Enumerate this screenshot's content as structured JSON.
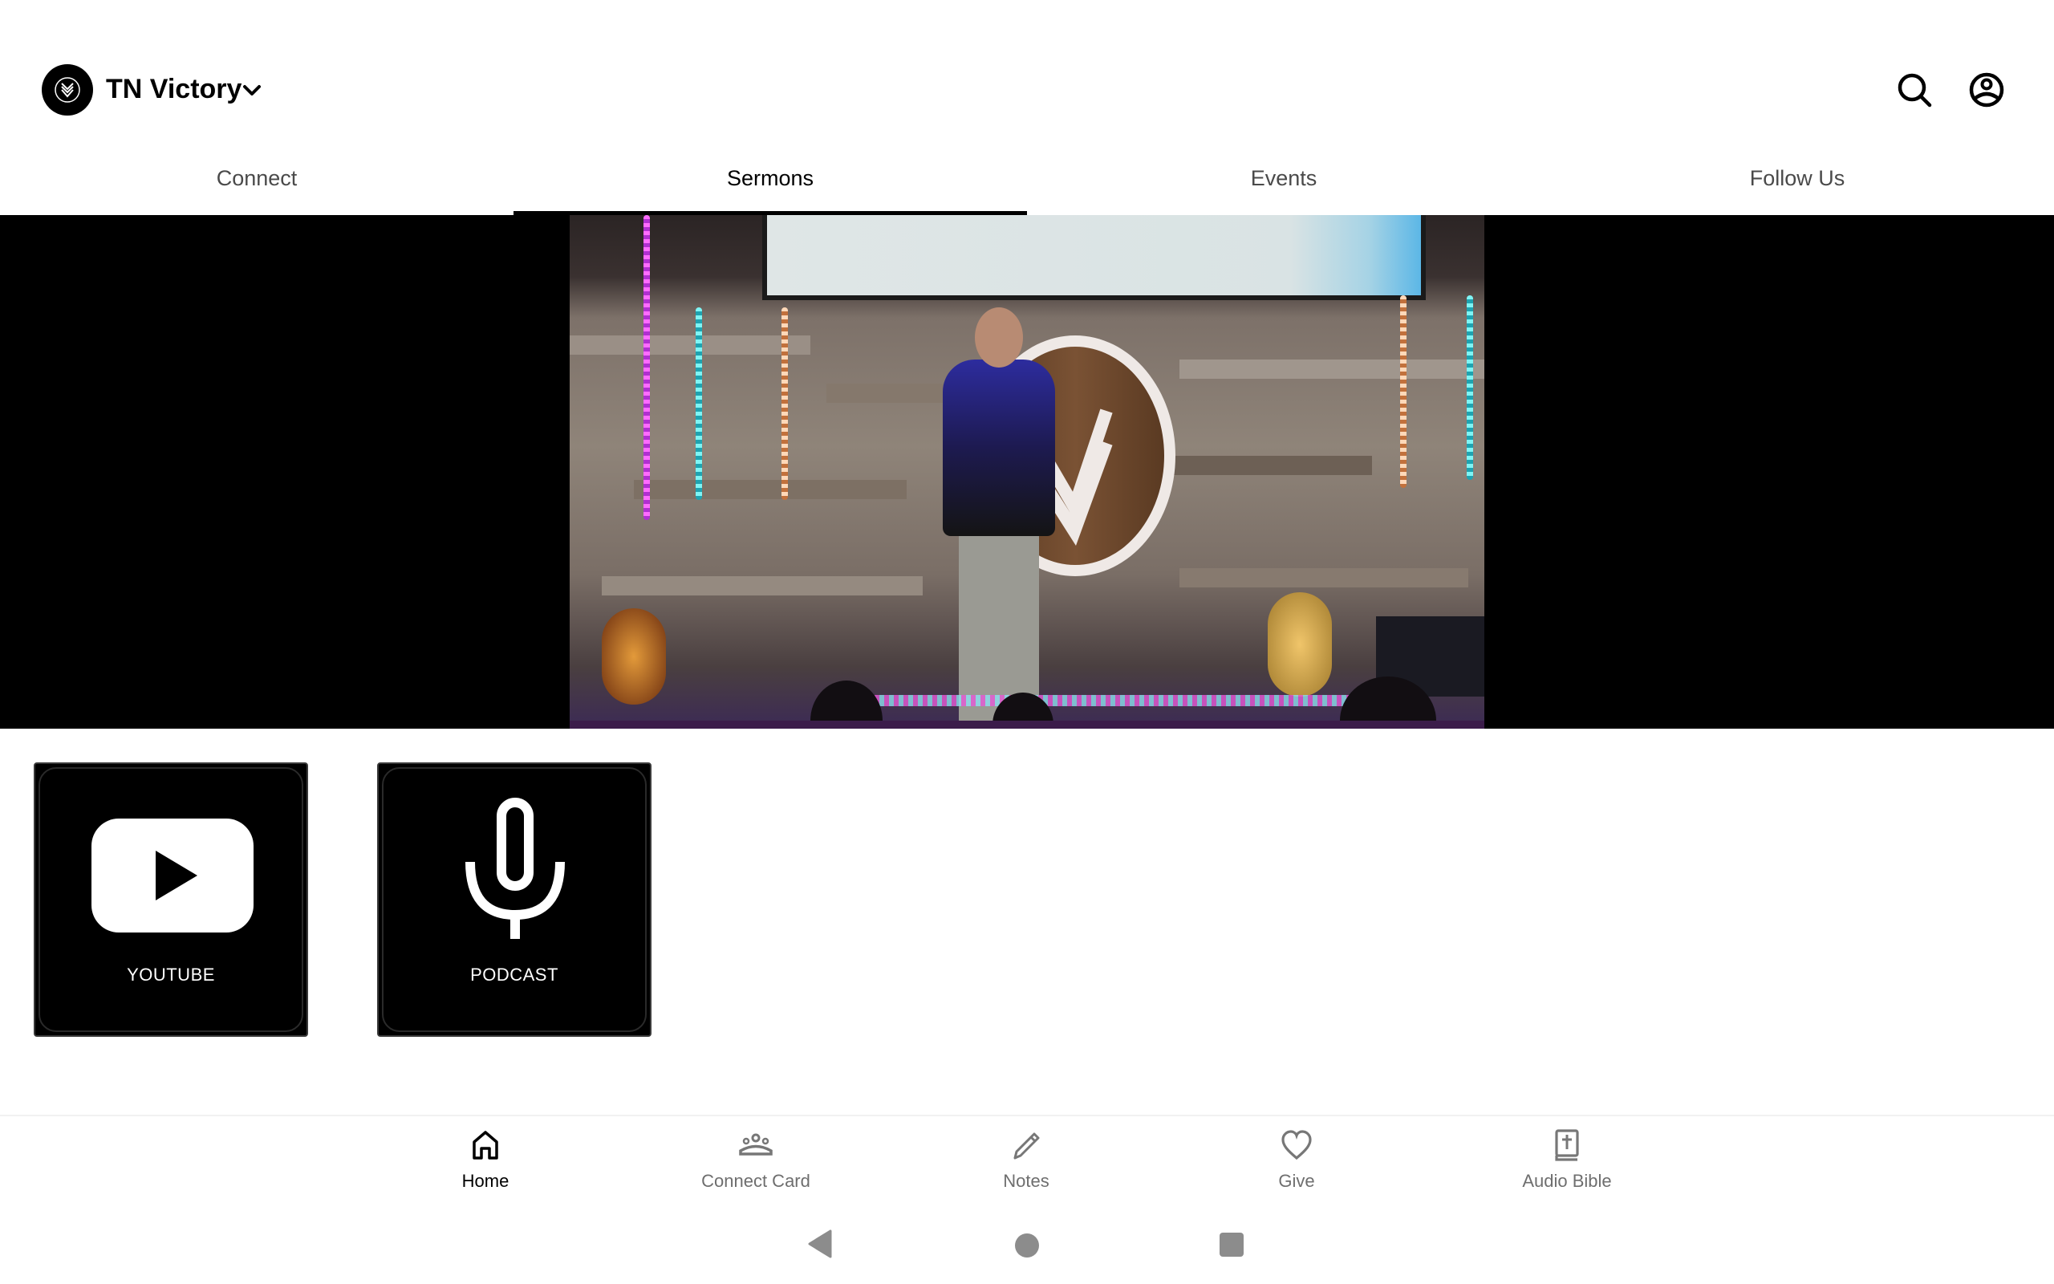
{
  "header": {
    "org_name": "TN Victory",
    "logo_icon": "victory-v-emblem",
    "dropdown_icon": "chevron-down-icon",
    "search_icon": "search-icon",
    "profile_icon": "account-circle-icon"
  },
  "tabs": [
    {
      "label": "Connect",
      "active": false
    },
    {
      "label": "Sermons",
      "active": true
    },
    {
      "label": "Events",
      "active": false
    },
    {
      "label": "Follow Us",
      "active": false
    }
  ],
  "hero": {
    "content": "Photo of a pastor speaking on stage in front of a wooden wall with a V logo"
  },
  "tiles": [
    {
      "label": "YOUTUBE",
      "icon": "youtube-icon"
    },
    {
      "label": "PODCAST",
      "icon": "microphone-icon"
    }
  ],
  "bottom_nav": [
    {
      "label": "Home",
      "icon": "home-icon",
      "active": true
    },
    {
      "label": "Connect Card",
      "icon": "groups-icon",
      "active": false
    },
    {
      "label": "Notes",
      "icon": "pencil-icon",
      "active": false
    },
    {
      "label": "Give",
      "icon": "heart-icon",
      "active": false
    },
    {
      "label": "Audio Bible",
      "icon": "bible-icon",
      "active": false
    }
  ],
  "system_nav": [
    "back",
    "home",
    "recents"
  ],
  "colors": {
    "active_text": "#000000",
    "inactive_tab": "#4a4a4a",
    "inactive_nav": "#6e6e6e",
    "tile_bg": "#000000"
  }
}
